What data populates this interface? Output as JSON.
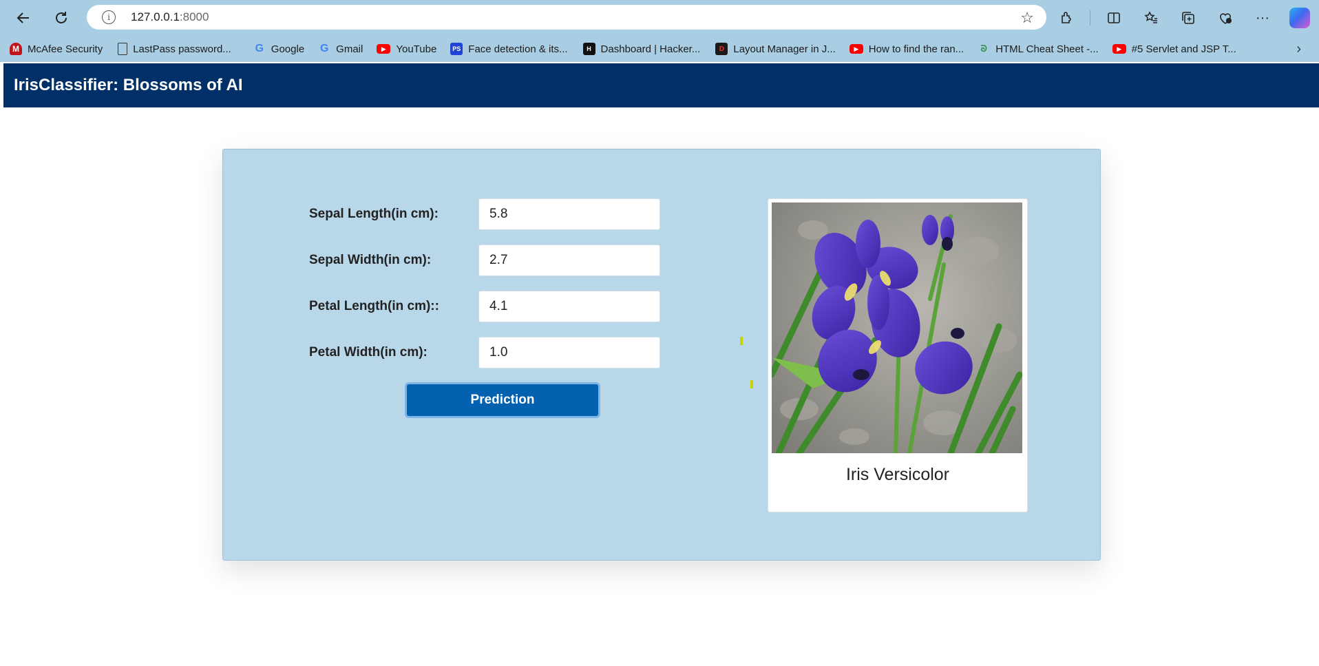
{
  "browser": {
    "url_host": "127.0.0.1",
    "url_port": ":8000",
    "bookmarks": [
      {
        "label": "McAfee Security",
        "icon": "mcafee-icon"
      },
      {
        "label": "LastPass password...",
        "icon": "document-icon"
      },
      {
        "label": "Google",
        "icon": "google-icon"
      },
      {
        "label": "Gmail",
        "icon": "google-icon"
      },
      {
        "label": "YouTube",
        "icon": "youtube-icon"
      },
      {
        "label": "Face detection & its...",
        "icon": "ps-icon"
      },
      {
        "label": "Dashboard | Hacker...",
        "icon": "hackerrank-icon"
      },
      {
        "label": "Layout Manager in J...",
        "icon": "d-icon"
      },
      {
        "label": "How to find the ran...",
        "icon": "youtube-icon"
      },
      {
        "label": "HTML Cheat Sheet -...",
        "icon": "gfg-icon"
      },
      {
        "label": "#5 Servlet and JSP T...",
        "icon": "youtube-icon"
      }
    ]
  },
  "app": {
    "title": "IrisClassifier: Blossoms of AI",
    "form": {
      "fields": [
        {
          "label": "Sepal Length(in cm):",
          "value": "5.8"
        },
        {
          "label": "Sepal Width(in cm):",
          "value": "2.7"
        },
        {
          "label": "Petal Length(in cm)::",
          "value": "4.1"
        },
        {
          "label": "Petal Width(in cm):",
          "value": "1.0"
        }
      ],
      "submit_label": "Prediction"
    },
    "result": {
      "species": "Iris Versicolor"
    }
  },
  "colors": {
    "header_bg": "#003067",
    "card_bg": "#b8d7e9",
    "button_bg": "#0461b0",
    "browser_chrome": "#a9cde3"
  }
}
